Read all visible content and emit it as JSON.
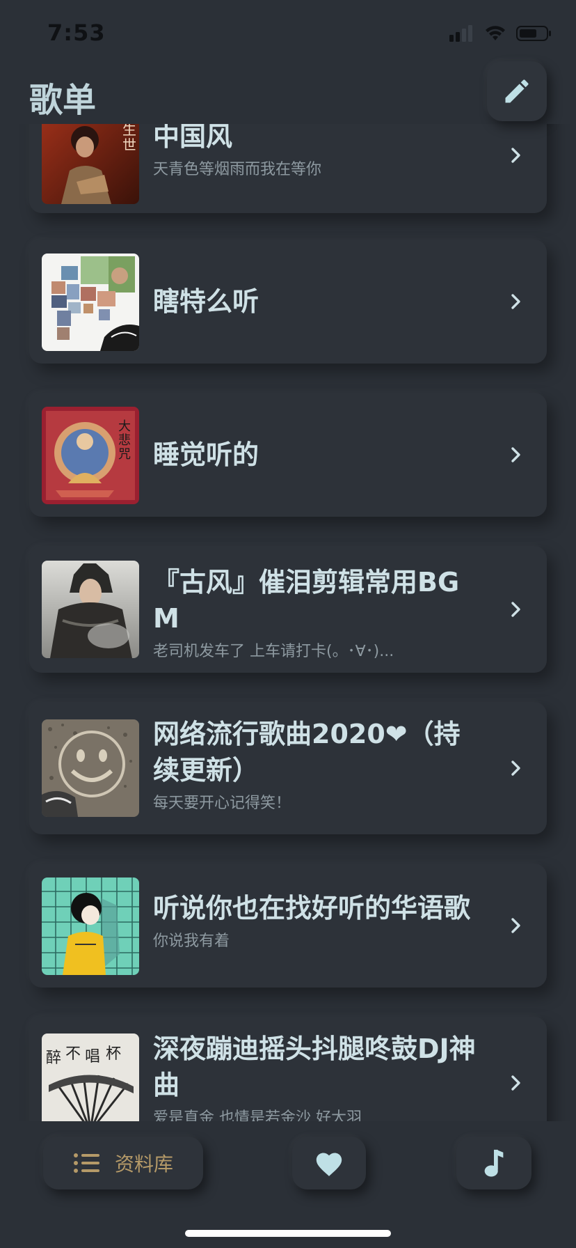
{
  "status_bar": {
    "time": "7:53"
  },
  "header": {
    "title": "歌单"
  },
  "playlists": [
    {
      "title": "中国风",
      "subtitle": "天青色等烟雨而我在等你"
    },
    {
      "title": "瞎特么听",
      "subtitle": ""
    },
    {
      "title": "睡觉听的",
      "subtitle": ""
    },
    {
      "title": "『古风』催泪剪辑常用BGM",
      "subtitle": "老司机发车了 上车请打卡(。･∀･)..."
    },
    {
      "title": "网络流行歌曲2020❤（持续更新）",
      "subtitle": "每天要开心记得笑！"
    },
    {
      "title": "听说你也在找好听的华语歌",
      "subtitle": "你说我有着"
    },
    {
      "title": "深夜蹦迪摇头抖腿咚鼓DJ神曲",
      "subtitle": "爱是直金 也情是若金沙 好大羽"
    }
  ],
  "tab_bar": {
    "library_label": "资料库"
  },
  "colors": {
    "background": "#2b3037",
    "card": "#2d3239",
    "accent_icon": "#bfe0e6",
    "library_accent": "#b59a68"
  }
}
